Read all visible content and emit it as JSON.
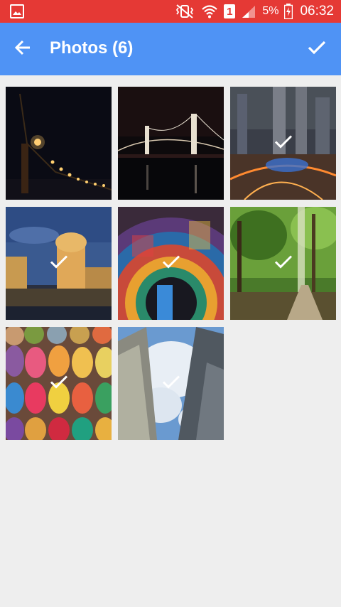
{
  "status_bar": {
    "battery_percent": "5%",
    "time": "06:32",
    "sim_slot": "1",
    "color": "#e53935",
    "icons": [
      "gallery-notification-icon",
      "vibrate-mute-icon",
      "wifi-icon",
      "sim-1-icon",
      "signal-icon",
      "battery-charging-icon"
    ]
  },
  "app_bar": {
    "title": "Photos (6)",
    "color": "#4f93f5",
    "back_icon": "arrow-back-icon",
    "done_icon": "check-icon"
  },
  "photos": [
    {
      "subject": "bridge-lights-night",
      "selected": false
    },
    {
      "subject": "rainbow-bridge-night",
      "selected": false
    },
    {
      "subject": "city-skyline-night",
      "selected": true
    },
    {
      "subject": "palace-fine-arts-dusk",
      "selected": true
    },
    {
      "subject": "colorful-tunnel",
      "selected": true
    },
    {
      "subject": "forest-path",
      "selected": true
    },
    {
      "subject": "yarn-balls",
      "selected": true
    },
    {
      "subject": "skyscrapers-sky",
      "selected": true
    }
  ]
}
